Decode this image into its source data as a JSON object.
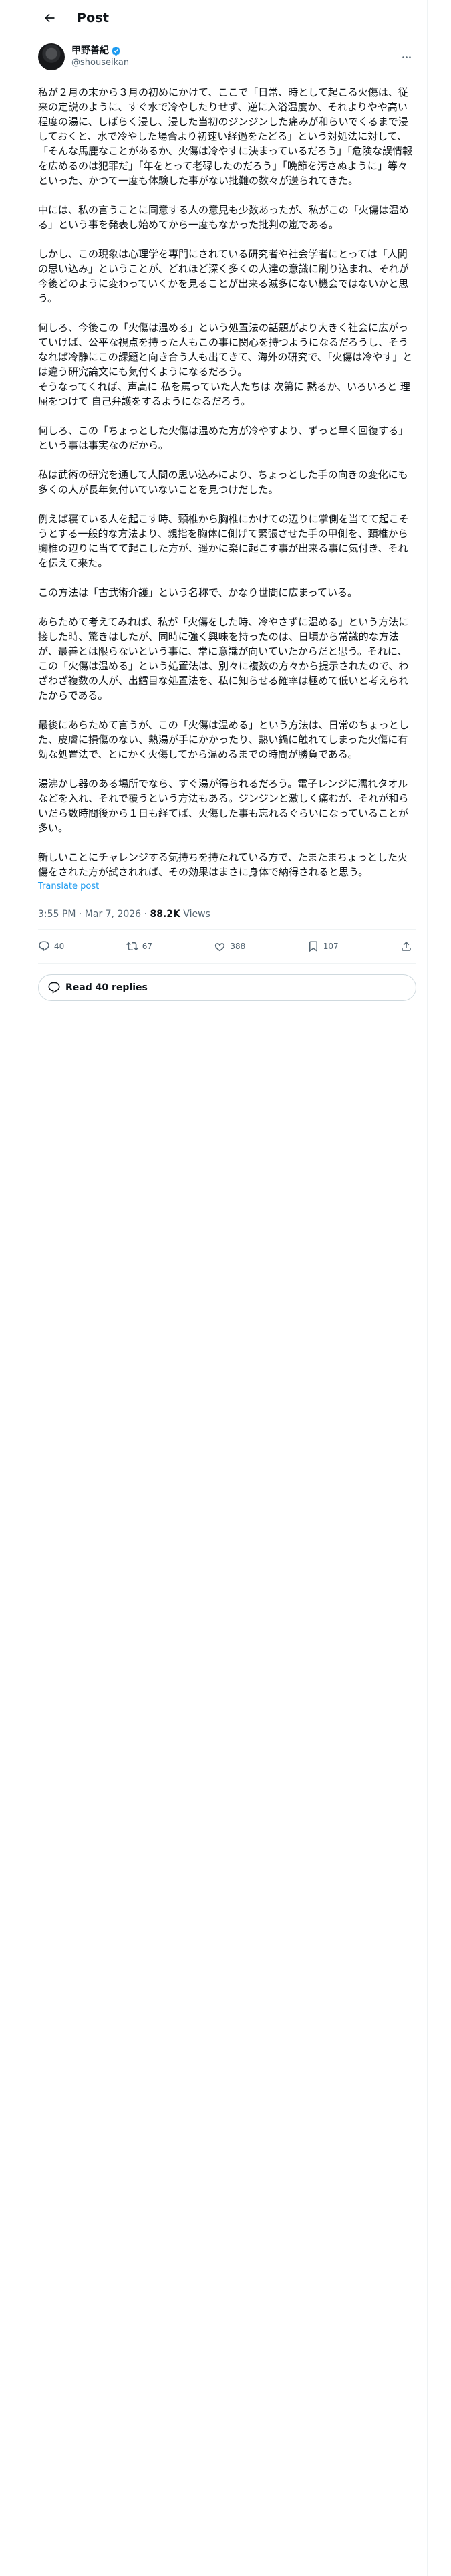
{
  "header": {
    "title": "Post",
    "back_icon": "arrow-left-icon"
  },
  "author": {
    "display_name": "甲野善紀",
    "handle": "@shouseikan",
    "verified_color": "#1d9bf0"
  },
  "post": {
    "paragraphs": [
      "私が２月の末から３月の初めにかけて、ここで「日常、時として起こる火傷は、従来の定説のように、すぐ水で冷やしたりせず、逆に入浴温度か、それよりやや高い程度の湯に、しばらく浸し、浸した当初のジンジンした痛みが和らいでくるまで浸しておくと、水で冷やした場合より初速い経過をたどる」という対処法に対して、「そんな馬鹿なことがあるか、火傷は冷やすに決まっているだろう」「危険な誤情報を広めるのは犯罪だ」「年をとって老碌したのだろう」「晩節を汚さぬように」等々といった、かつて一度も体験した事がない批難の数々が送られてきた。",
      "中には、私の言うことに同意する人の意見も少数あったが、私がこの「火傷は温める」という事を発表し始めてから一度もなかった批判の嵐である。",
      "しかし、この現象は心理学を専門にされている研究者や社会学者にとっては「人間の思い込み」ということが、どれほど深く多くの人達の意識に刷り込まれ、それが今後どのように変わっていくかを見ることが出来る滅多にない機会ではないかと思う。",
      "何しろ、今後この「火傷は温める」という処置法の話題がより大きく社会に広がっていけば、公平な視点を持った人もこの事に関心を持つようになるだろうし、そうなれば冷静にこの課題と向き合う人も出てきて、海外の研究で、「火傷は冷やす」とは違う研究論文にも気付くようになるだろう。\nそうなってくれば、声高に 私を罵っていた人たちは 次第に 黙るか、いろいろと 理屈をつけて 自己弁護をするようになるだろう。",
      "何しろ、この「ちょっとした火傷は温めた方が冷やすより、ずっと早く回復する」という事は事実なのだから。",
      "私は武術の研究を通して人間の思い込みにより、ちょっとした手の向きの変化にも多くの人が長年気付いていないことを見つけだした。",
      "例えば寝ている人を起こす時、頸椎から胸椎にかけての辺りに掌側を当てて起こそうとする一般的な方法より、親指を胸体に側げて緊張させた手の甲側を、頸椎から胸椎の辺りに当てて起こした方が、遥かに楽に起こす事が出来る事に気付き、それを伝えて来た。",
      "この方法は「古武術介護」という名称で、かなり世間に広まっている。",
      "あらためて考えてみれば、私が「火傷をした時、冷やさずに温める」という方法に接した時、驚きはしたが、同時に強く興味を持ったのは、日頃から常識的な方法が、最善とは限らないという事に、常に意識が向いていたからだと思う。それに、この「火傷は温める」という処置法は、別々に複数の方々から提示されたので、わざわざ複数の人が、出鱈目な処置法を、私に知らせる確率は極めて低いと考えられたからである。",
      "最後にあらためて言うが、この「火傷は温める」という方法は、日常のちょっとした、皮膚に損傷のない、熱湯が手にかかったり、熱い鍋に触れてしまった火傷に有効な処置法で、とにかく火傷してから温めるまでの時間が勝負である。",
      "湯沸かし器のある場所でなら、すぐ湯が得られるだろう。電子レンジに濡れタオルなどを入れ、それで覆うという方法もある。ジンジンと激しく痛むが、それが和らいだら数時間後から１日も経てば、火傷した事も忘れるぐらいになっていることが多い。",
      "新しいことにチャレンジする気持ちを持たれている方で、たまたまちょっとした火傷をされた方が試されれば、その効果はまさに身体で納得されると思う。"
    ],
    "translate_label": "Translate post"
  },
  "meta": {
    "time": "3:55 PM",
    "separator": " · ",
    "date": "Mar 7, 2026",
    "views_count": "88.2K",
    "views_label": " Views"
  },
  "actions": {
    "replies": "40",
    "reposts": "67",
    "likes": "388",
    "bookmarks": "107"
  },
  "read_replies_label": "Read 40 replies"
}
